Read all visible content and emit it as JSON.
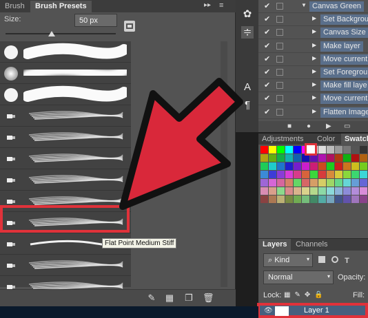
{
  "brush_panel": {
    "tabs": [
      {
        "label": "Brush"
      },
      {
        "label": "Brush Presets"
      }
    ],
    "size_label": "Size:",
    "size_value": "50 px",
    "slider_level_fraction": 0.42,
    "tooltip": "Flat Point Medium Stiff",
    "selected_row_index": 9
  },
  "actions_panel": {
    "rows": [
      {
        "label": "Canvas Green",
        "checked": true,
        "expanded": true
      },
      {
        "label": "Set Backgrou",
        "checked": true
      },
      {
        "label": "Canvas Size",
        "checked": true
      },
      {
        "label": "Make layer",
        "checked": true
      },
      {
        "label": "Move current",
        "checked": true
      },
      {
        "label": "Set Foregrou",
        "checked": true
      },
      {
        "label": "Make fill laye",
        "checked": true
      },
      {
        "label": "Move current",
        "checked": true
      },
      {
        "label": "Flatten Image",
        "checked": true
      }
    ]
  },
  "swatch_panel": {
    "tabs": [
      {
        "label": "Adjustments"
      },
      {
        "label": "Color"
      },
      {
        "label": "Swatch"
      }
    ],
    "picked_color": "#ffffff",
    "first_row_colors": [
      "#ff0000",
      "#ffff00",
      "#00ff00",
      "#00ffff",
      "#0000ff",
      "#ff00ff",
      "#ffffff",
      "#dddddd",
      "#bbbbbb",
      "#999999",
      "#777777",
      "#555555",
      "#333333"
    ]
  },
  "layers_panel": {
    "tabs": [
      {
        "label": "Layers"
      },
      {
        "label": "Channels"
      }
    ],
    "filter_label": "Kind",
    "blend_mode": "Normal",
    "opacity_label": "Opacity:",
    "lock_label": "Lock:",
    "fill_label": "Fill:",
    "layer_name": "Layer 1"
  },
  "colors": {
    "highlight_red": "#e0323a",
    "panel_bg": "#535353",
    "selection_blue": "#5a6f8b"
  }
}
